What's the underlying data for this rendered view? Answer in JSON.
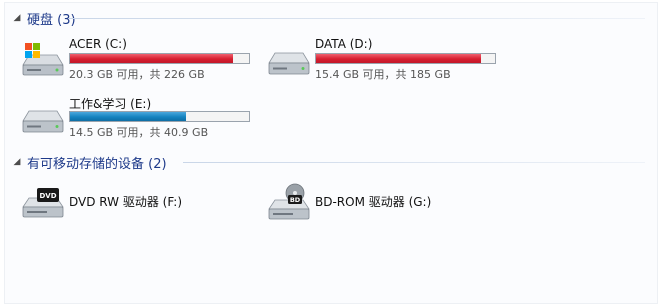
{
  "groups": {
    "hard_disks": {
      "title": "硬盘 (3)",
      "drives": [
        {
          "name": "ACER (C:)",
          "size_text": "20.3 GB 可用，共 226 GB",
          "used_fraction": 0.91,
          "bar_color": "#d71f30",
          "icon": "windows-drive-icon"
        },
        {
          "name": "DATA (D:)",
          "size_text": "15.4 GB 可用，共 185 GB",
          "used_fraction": 0.92,
          "bar_color": "#d71f30",
          "icon": "hard-drive-icon"
        },
        {
          "name": "工作&学习 (E:)",
          "size_text": "14.5 GB 可用，共 40.9 GB",
          "used_fraction": 0.65,
          "bar_color": "#1583bf",
          "icon": "hard-drive-icon"
        }
      ]
    },
    "removable": {
      "title": "有可移动存储的设备 (2)",
      "devices": [
        {
          "name": "DVD RW 驱动器 (F:)",
          "icon": "dvd-drive-icon",
          "disc_label": "DVD"
        },
        {
          "name": "BD-ROM 驱动器 (G:)",
          "icon": "bd-drive-icon",
          "disc_label": "BD"
        }
      ]
    }
  }
}
